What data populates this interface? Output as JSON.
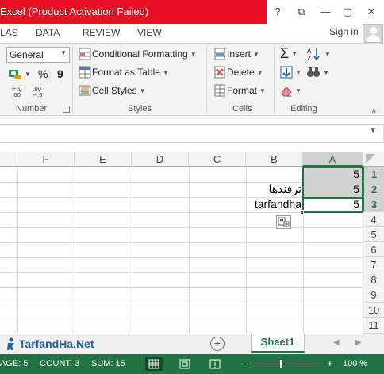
{
  "window": {
    "title": "Excel (Product Activation Failed)",
    "help": "?",
    "restore": "⧉",
    "minimize": "—",
    "close": "✕"
  },
  "ribbon_tabs": [
    "LAS",
    "DATA",
    "REVIEW",
    "VIEW"
  ],
  "signin": "Sign in",
  "number_group": {
    "format": "General",
    "percent": "%",
    "comma": "9",
    "label": "Number"
  },
  "styles_group": {
    "conditional_formatting": "Conditional Formatting",
    "format_as_table": "Format as Table",
    "cell_styles": "Cell Styles",
    "label": "Styles"
  },
  "cells_group": {
    "insert": "Insert",
    "delete": "Delete",
    "format": "Format",
    "label": "Cells"
  },
  "editing_group": {
    "label": "Editing"
  },
  "columns": [
    "F",
    "E",
    "D",
    "C",
    "B",
    "A"
  ],
  "rows": [
    "1",
    "2",
    "3",
    "4",
    "5",
    "6",
    "7",
    "8",
    "9",
    "10",
    "11"
  ],
  "cells": {
    "A1": "5",
    "A2": "5",
    "A3": "5",
    "B2": "ترفندها",
    "B3": "tarfandha"
  },
  "sheet": {
    "brand": "TarfandHa.Net",
    "tab_name": "Sheet1",
    "add": "+"
  },
  "status": {
    "average": "AGE: 5",
    "count": "COUNT: 3",
    "sum": "SUM: 15",
    "zoom_minus": "–",
    "zoom_plus": "+",
    "zoom": "100 %"
  },
  "colors": {
    "excel_green": "#217346",
    "title_red": "#e81123",
    "brand_blue": "#1f5fa8"
  }
}
